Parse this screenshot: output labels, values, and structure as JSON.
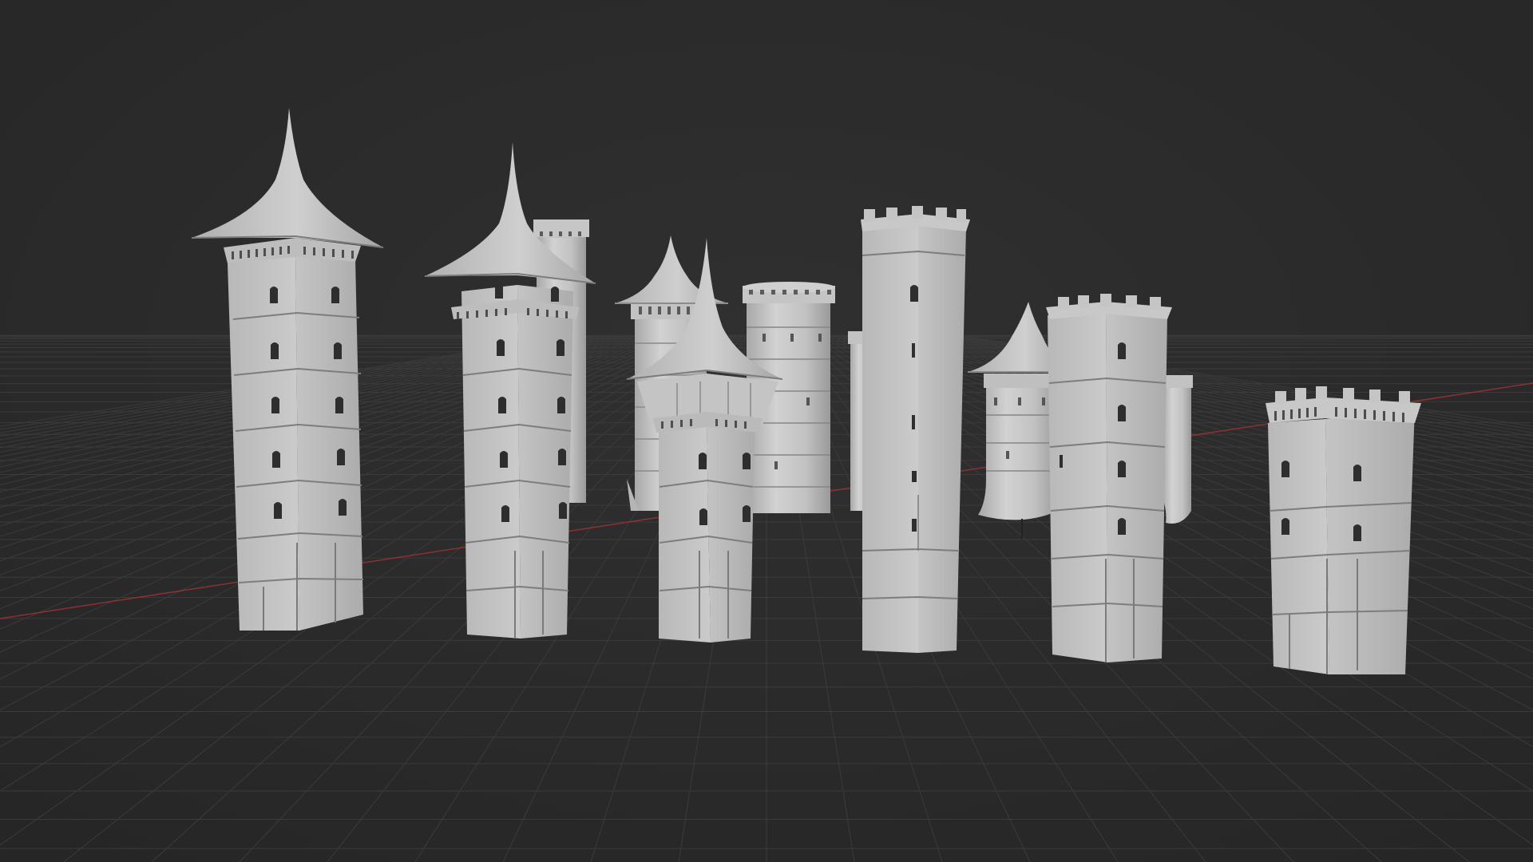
{
  "viewport": {
    "background_color": "#2b2b2b",
    "grid_color": "#3b3b3b",
    "x_axis_color": "#a13434",
    "model_color": "#c9c9c9"
  },
  "scene": {
    "objects": [
      {
        "name": "tower-square-spire-1",
        "kind": "square tower with pagoda spire"
      },
      {
        "name": "tower-square-spire-2",
        "kind": "square tower with pagoda spire"
      },
      {
        "name": "tower-round-crenellated-back-left",
        "kind": "round crenellated tower"
      },
      {
        "name": "tower-round-cone-back",
        "kind": "round tower with cone roof"
      },
      {
        "name": "tower-round-crenellated-back-mid",
        "kind": "round crenellated tower"
      },
      {
        "name": "tower-square-spire-front",
        "kind": "square tower with pagoda spire"
      },
      {
        "name": "tower-round-partial-back",
        "kind": "round tower (partially hidden)"
      },
      {
        "name": "tower-tall-square-crenellated",
        "kind": "tall square crenellated tower"
      },
      {
        "name": "tower-round-cone-right",
        "kind": "round tower with cone roof"
      },
      {
        "name": "tower-round-partial-right",
        "kind": "round tower (partially hidden)"
      },
      {
        "name": "tower-square-crenellated-mid-right",
        "kind": "square crenellated tower"
      },
      {
        "name": "tower-square-crenellated-far-right",
        "kind": "square crenellated tower with machicolations"
      }
    ]
  }
}
